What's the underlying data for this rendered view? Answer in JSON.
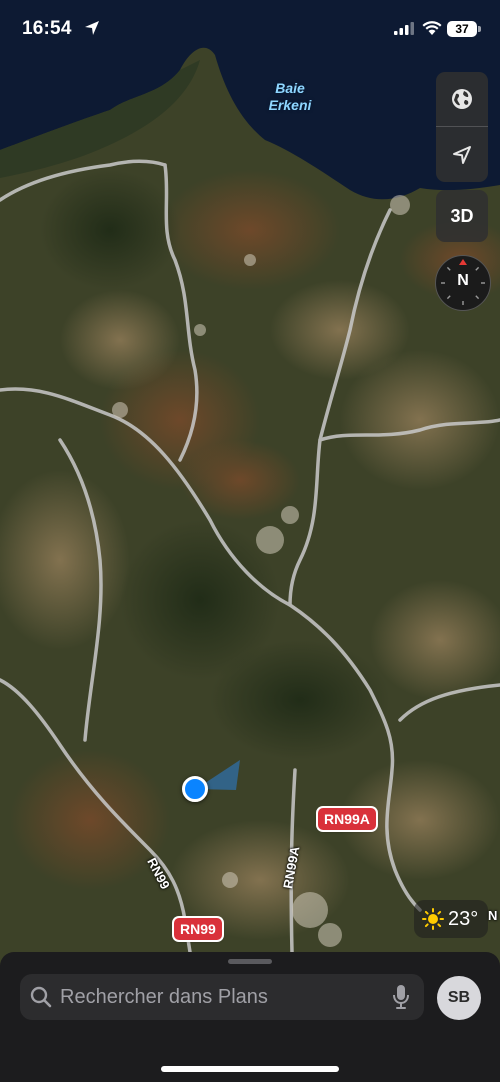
{
  "status_bar": {
    "time": "16:54",
    "battery": "37"
  },
  "map": {
    "bay_label_line1": "Baie",
    "bay_label_line2": "Erkeni",
    "road_shields": [
      "RN99A",
      "RN99"
    ],
    "road_labels": [
      "RN99",
      "RN99A",
      "N"
    ],
    "colors": {
      "sea": "#0d1a33",
      "terrain": "#3d4228",
      "road": "#c9c9c9",
      "shield": "#d9313a",
      "user_location": "#0a84ff"
    }
  },
  "controls": {
    "map_mode_icon": "globe-icon",
    "locate_icon": "location-arrow-icon",
    "view_3d_label": "3D",
    "compass_label": "N"
  },
  "weather": {
    "icon": "sun-icon",
    "temperature": "23°"
  },
  "search_sheet": {
    "placeholder": "Rechercher dans Plans",
    "avatar_initials": "SB"
  }
}
